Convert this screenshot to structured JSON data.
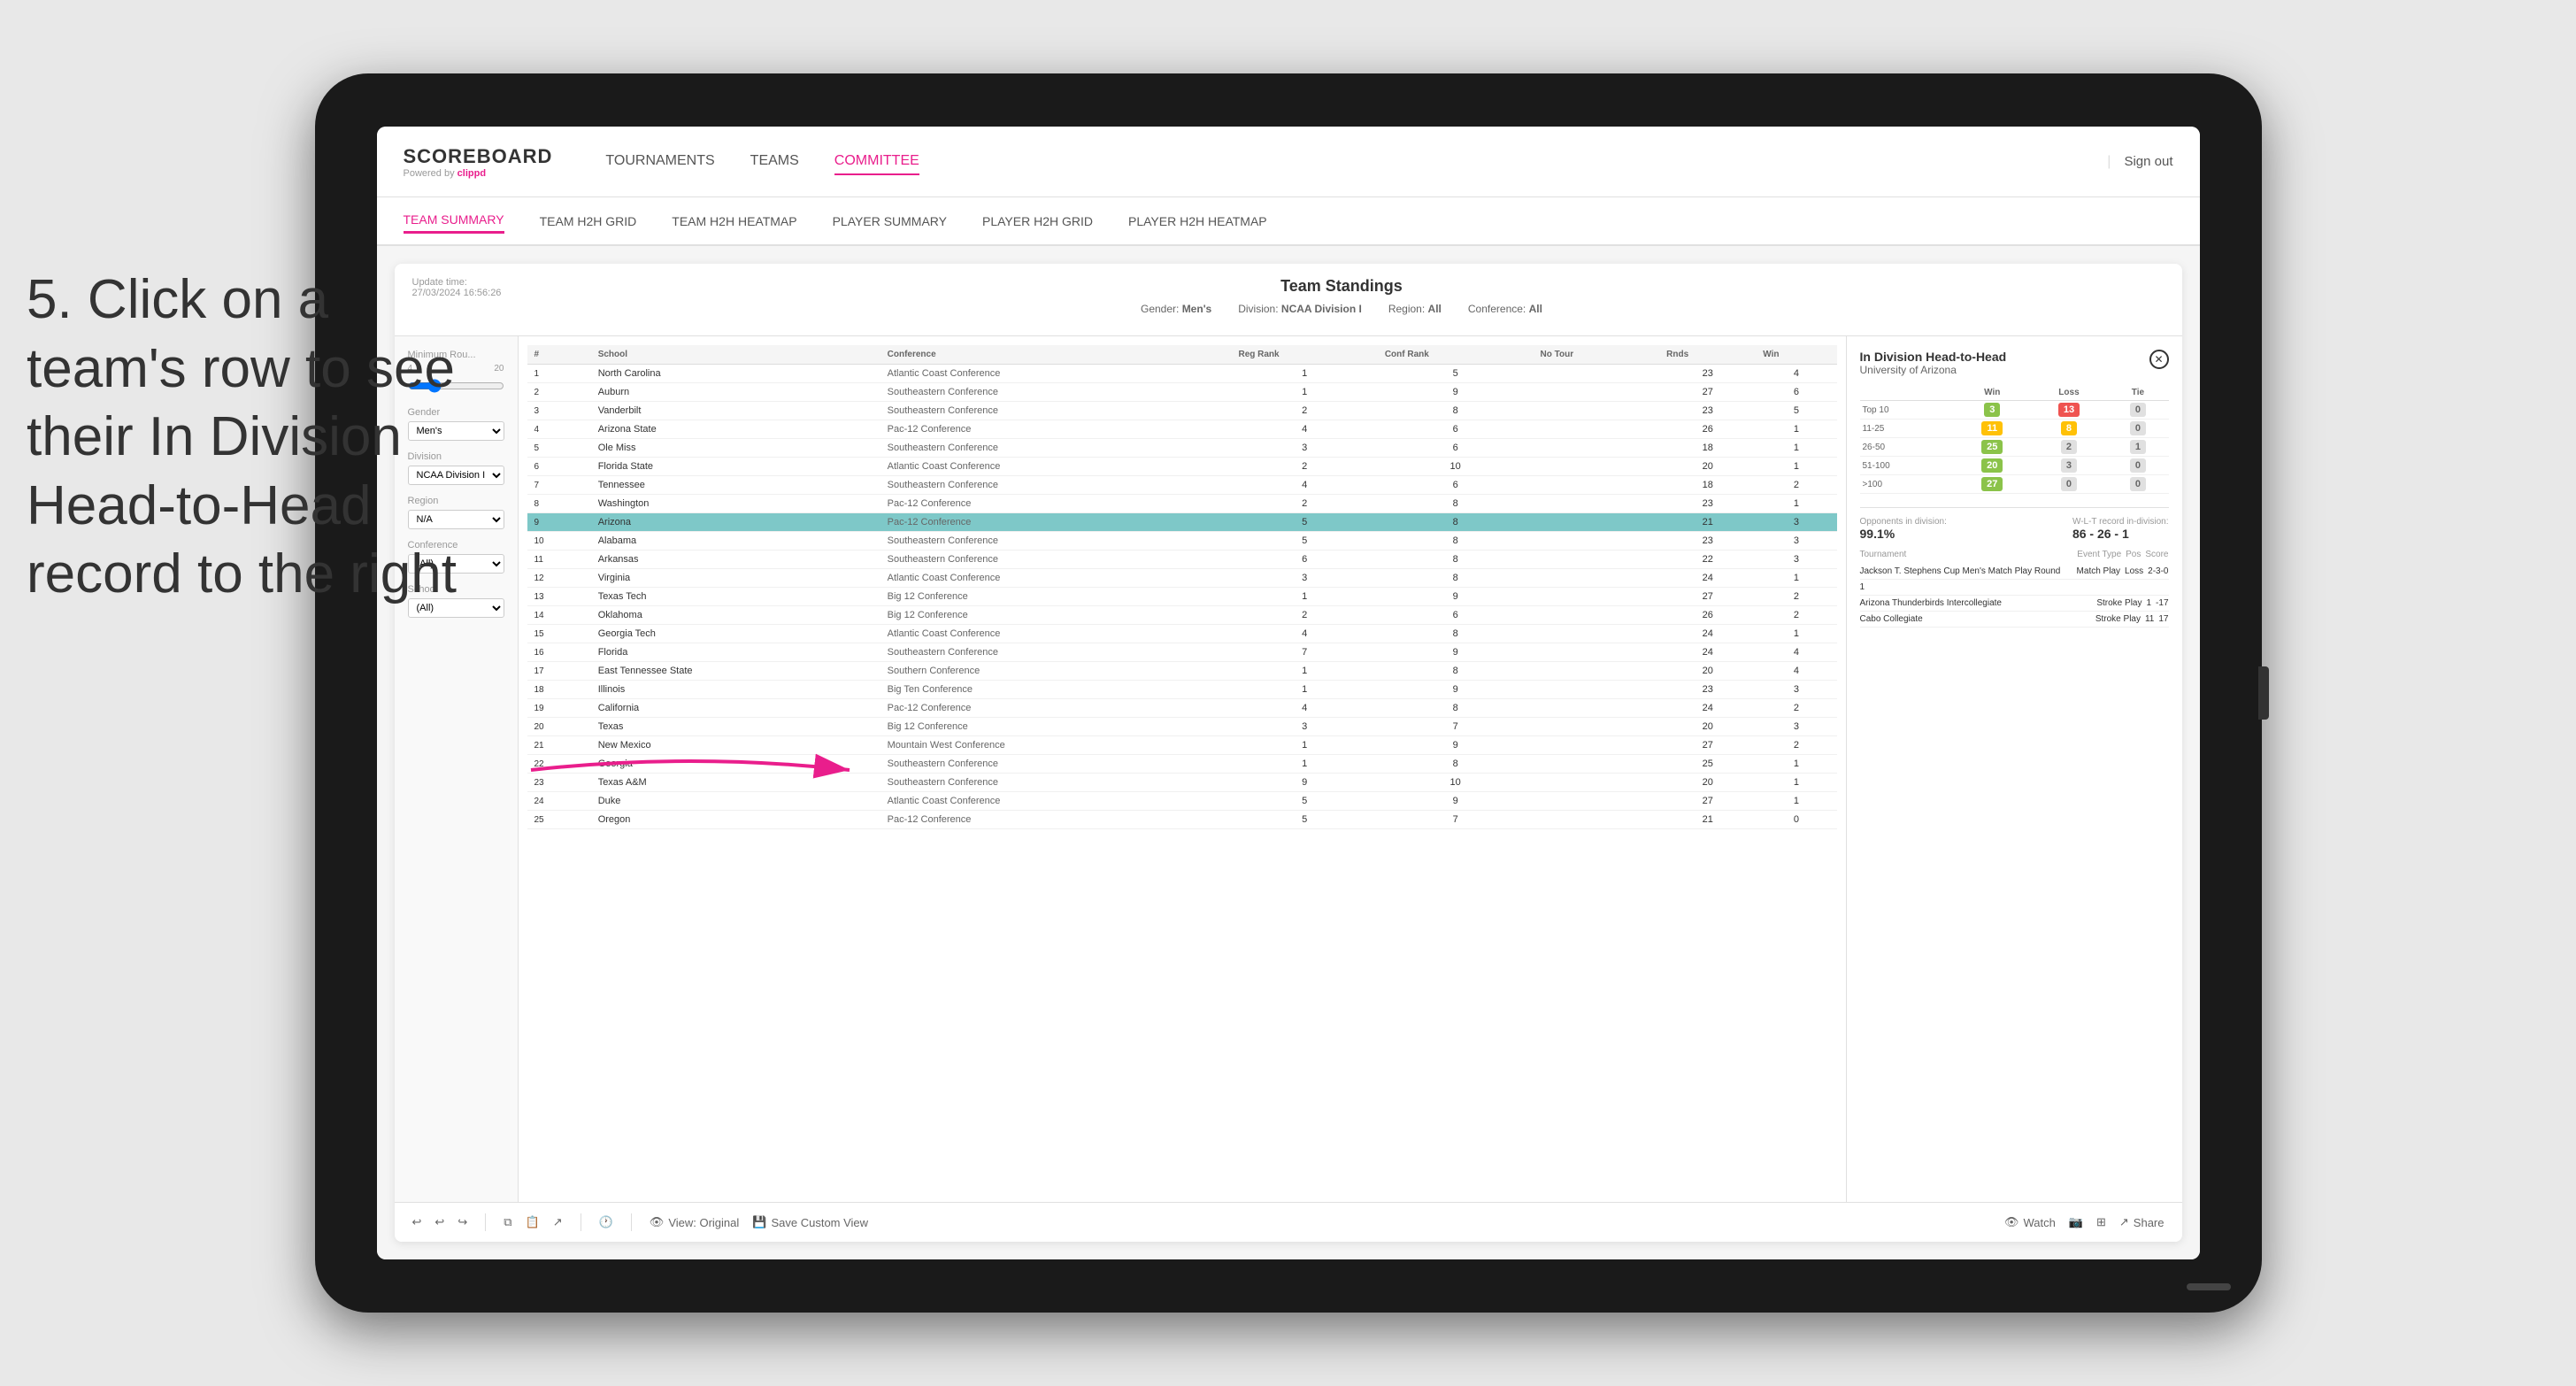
{
  "page": {
    "background": "#e8e8e8"
  },
  "annotation": {
    "step": "5. Click on a team's row to see their In Division Head-to-Head record to the right"
  },
  "nav": {
    "logo": "SCOREBOARD",
    "logo_sub": "Powered by clippd",
    "links": [
      "TOURNAMENTS",
      "TEAMS",
      "COMMITTEE"
    ],
    "active_link": "COMMITTEE",
    "sign_out": "Sign out"
  },
  "sub_nav": {
    "links": [
      "TEAM SUMMARY",
      "TEAM H2H GRID",
      "TEAM H2H HEATMAP",
      "PLAYER SUMMARY",
      "PLAYER H2H GRID",
      "PLAYER H2H HEATMAP"
    ],
    "active_link": "TEAM SUMMARY"
  },
  "panel": {
    "update_time_label": "Update time:",
    "update_time": "27/03/2024 16:56:26",
    "title": "Team Standings",
    "gender_label": "Gender:",
    "gender": "Men's",
    "division_label": "Division:",
    "division": "NCAA Division I",
    "region_label": "Region:",
    "region": "All",
    "conference_label": "Conference:",
    "conference": "All"
  },
  "filters": {
    "minimum_rounds_label": "Minimum Rou...",
    "min_val": "4",
    "max_val": "20",
    "gender_label": "Gender",
    "gender_value": "Men's",
    "division_label": "Division",
    "division_value": "NCAA Division I",
    "region_label": "Region",
    "region_value": "N/A",
    "conference_label": "Conference",
    "conference_value": "(All)",
    "school_label": "School",
    "school_value": "(All)"
  },
  "table": {
    "headers": [
      "#",
      "School",
      "Conference",
      "Reg Rank",
      "Conf Rank",
      "No Tour",
      "Rnds",
      "Win"
    ],
    "rows": [
      {
        "rank": 1,
        "school": "North Carolina",
        "conference": "Atlantic Coast Conference",
        "reg_rank": 1,
        "conf_rank": 5,
        "no_tour": "",
        "rnds": 23,
        "win": 4
      },
      {
        "rank": 2,
        "school": "Auburn",
        "conference": "Southeastern Conference",
        "reg_rank": 1,
        "conf_rank": 9,
        "no_tour": "",
        "rnds": 27,
        "win": 6
      },
      {
        "rank": 3,
        "school": "Vanderbilt",
        "conference": "Southeastern Conference",
        "reg_rank": 2,
        "conf_rank": 8,
        "no_tour": "",
        "rnds": 23,
        "win": 5
      },
      {
        "rank": 4,
        "school": "Arizona State",
        "conference": "Pac-12 Conference",
        "reg_rank": 4,
        "conf_rank": 6,
        "no_tour": "",
        "rnds": 26,
        "win": 1
      },
      {
        "rank": 5,
        "school": "Ole Miss",
        "conference": "Southeastern Conference",
        "reg_rank": 3,
        "conf_rank": 6,
        "no_tour": "",
        "rnds": 18,
        "win": 1
      },
      {
        "rank": 6,
        "school": "Florida State",
        "conference": "Atlantic Coast Conference",
        "reg_rank": 2,
        "conf_rank": 10,
        "no_tour": "",
        "rnds": 20,
        "win": 1
      },
      {
        "rank": 7,
        "school": "Tennessee",
        "conference": "Southeastern Conference",
        "reg_rank": 4,
        "conf_rank": 6,
        "no_tour": "",
        "rnds": 18,
        "win": 2
      },
      {
        "rank": 8,
        "school": "Washington",
        "conference": "Pac-12 Conference",
        "reg_rank": 2,
        "conf_rank": 8,
        "no_tour": "",
        "rnds": 23,
        "win": 1
      },
      {
        "rank": 9,
        "school": "Arizona",
        "conference": "Pac-12 Conference",
        "reg_rank": 5,
        "conf_rank": 8,
        "no_tour": "",
        "rnds": 21,
        "win": 3,
        "highlighted": true
      },
      {
        "rank": 10,
        "school": "Alabama",
        "conference": "Southeastern Conference",
        "reg_rank": 5,
        "conf_rank": 8,
        "no_tour": "",
        "rnds": 23,
        "win": 3
      },
      {
        "rank": 11,
        "school": "Arkansas",
        "conference": "Southeastern Conference",
        "reg_rank": 6,
        "conf_rank": 8,
        "no_tour": "",
        "rnds": 22,
        "win": 3
      },
      {
        "rank": 12,
        "school": "Virginia",
        "conference": "Atlantic Coast Conference",
        "reg_rank": 3,
        "conf_rank": 8,
        "no_tour": "",
        "rnds": 24,
        "win": 1
      },
      {
        "rank": 13,
        "school": "Texas Tech",
        "conference": "Big 12 Conference",
        "reg_rank": 1,
        "conf_rank": 9,
        "no_tour": "",
        "rnds": 27,
        "win": 2
      },
      {
        "rank": 14,
        "school": "Oklahoma",
        "conference": "Big 12 Conference",
        "reg_rank": 2,
        "conf_rank": 6,
        "no_tour": "",
        "rnds": 26,
        "win": 2
      },
      {
        "rank": 15,
        "school": "Georgia Tech",
        "conference": "Atlantic Coast Conference",
        "reg_rank": 4,
        "conf_rank": 8,
        "no_tour": "",
        "rnds": 24,
        "win": 1
      },
      {
        "rank": 16,
        "school": "Florida",
        "conference": "Southeastern Conference",
        "reg_rank": 7,
        "conf_rank": 9,
        "no_tour": "",
        "rnds": 24,
        "win": 4
      },
      {
        "rank": 17,
        "school": "East Tennessee State",
        "conference": "Southern Conference",
        "reg_rank": 1,
        "conf_rank": 8,
        "no_tour": "",
        "rnds": 20,
        "win": 4
      },
      {
        "rank": 18,
        "school": "Illinois",
        "conference": "Big Ten Conference",
        "reg_rank": 1,
        "conf_rank": 9,
        "no_tour": "",
        "rnds": 23,
        "win": 3
      },
      {
        "rank": 19,
        "school": "California",
        "conference": "Pac-12 Conference",
        "reg_rank": 4,
        "conf_rank": 8,
        "no_tour": "",
        "rnds": 24,
        "win": 2
      },
      {
        "rank": 20,
        "school": "Texas",
        "conference": "Big 12 Conference",
        "reg_rank": 3,
        "conf_rank": 7,
        "no_tour": "",
        "rnds": 20,
        "win": 3
      },
      {
        "rank": 21,
        "school": "New Mexico",
        "conference": "Mountain West Conference",
        "reg_rank": 1,
        "conf_rank": 9,
        "no_tour": "",
        "rnds": 27,
        "win": 2
      },
      {
        "rank": 22,
        "school": "Georgia",
        "conference": "Southeastern Conference",
        "reg_rank": 1,
        "conf_rank": 8,
        "no_tour": "",
        "rnds": 25,
        "win": 1
      },
      {
        "rank": 23,
        "school": "Texas A&M",
        "conference": "Southeastern Conference",
        "reg_rank": 9,
        "conf_rank": 10,
        "no_tour": "",
        "rnds": 20,
        "win": 1
      },
      {
        "rank": 24,
        "school": "Duke",
        "conference": "Atlantic Coast Conference",
        "reg_rank": 5,
        "conf_rank": 9,
        "no_tour": "",
        "rnds": 27,
        "win": 1
      },
      {
        "rank": 25,
        "school": "Oregon",
        "conference": "Pac-12 Conference",
        "reg_rank": 5,
        "conf_rank": 7,
        "no_tour": "",
        "rnds": 21,
        "win": 0
      }
    ]
  },
  "division_h2h": {
    "title": "In Division Head-to-Head",
    "subtitle": "University of Arizona",
    "headers": [
      "",
      "Win",
      "Loss",
      "Tie"
    ],
    "rows": [
      {
        "label": "Top 10",
        "win": 3,
        "loss": 13,
        "tie": 0,
        "win_color": "green",
        "loss_color": "red",
        "tie_color": "gray"
      },
      {
        "label": "11-25",
        "win": 11,
        "loss": 8,
        "tie": 0,
        "win_color": "yellow",
        "loss_color": "yellow",
        "tie_color": "gray"
      },
      {
        "label": "26-50",
        "win": 25,
        "loss": 2,
        "tie": 1,
        "win_color": "green",
        "loss_color": "gray",
        "tie_color": "gray"
      },
      {
        "label": "51-100",
        "win": 20,
        "loss": 3,
        "tie": 0,
        "win_color": "green",
        "loss_color": "gray",
        "tie_color": "gray"
      },
      {
        "label": ">100",
        "win": 27,
        "loss": 0,
        "tie": 0,
        "win_color": "green",
        "loss_color": "gray",
        "tie_color": "gray"
      }
    ],
    "opponents_label": "Opponents in division:",
    "opponents_value": "99.1%",
    "record_label": "W-L-T record in-division:",
    "record_value": "86 - 26 - 1",
    "tournament_headers": [
      "Tournament",
      "Event Type",
      "Pos",
      "Score"
    ],
    "tournaments": [
      {
        "name": "Jackson T. Stephens Cup Men's Match Play Round",
        "event_type": "Match Play",
        "pos": "Loss",
        "score": "2-3-0"
      },
      {
        "name": "1",
        "event_type": "",
        "pos": "",
        "score": ""
      },
      {
        "name": "Arizona Thunderbirds Intercollegiate",
        "event_type": "Stroke Play",
        "pos": "1",
        "score": "-17"
      },
      {
        "name": "Cabo Collegiate",
        "event_type": "Stroke Play",
        "pos": "11",
        "score": "17"
      }
    ]
  },
  "toolbar": {
    "undo": "↩",
    "redo": "↪",
    "view_original": "View: Original",
    "save_custom": "Save Custom View",
    "watch": "Watch",
    "share": "Share"
  }
}
